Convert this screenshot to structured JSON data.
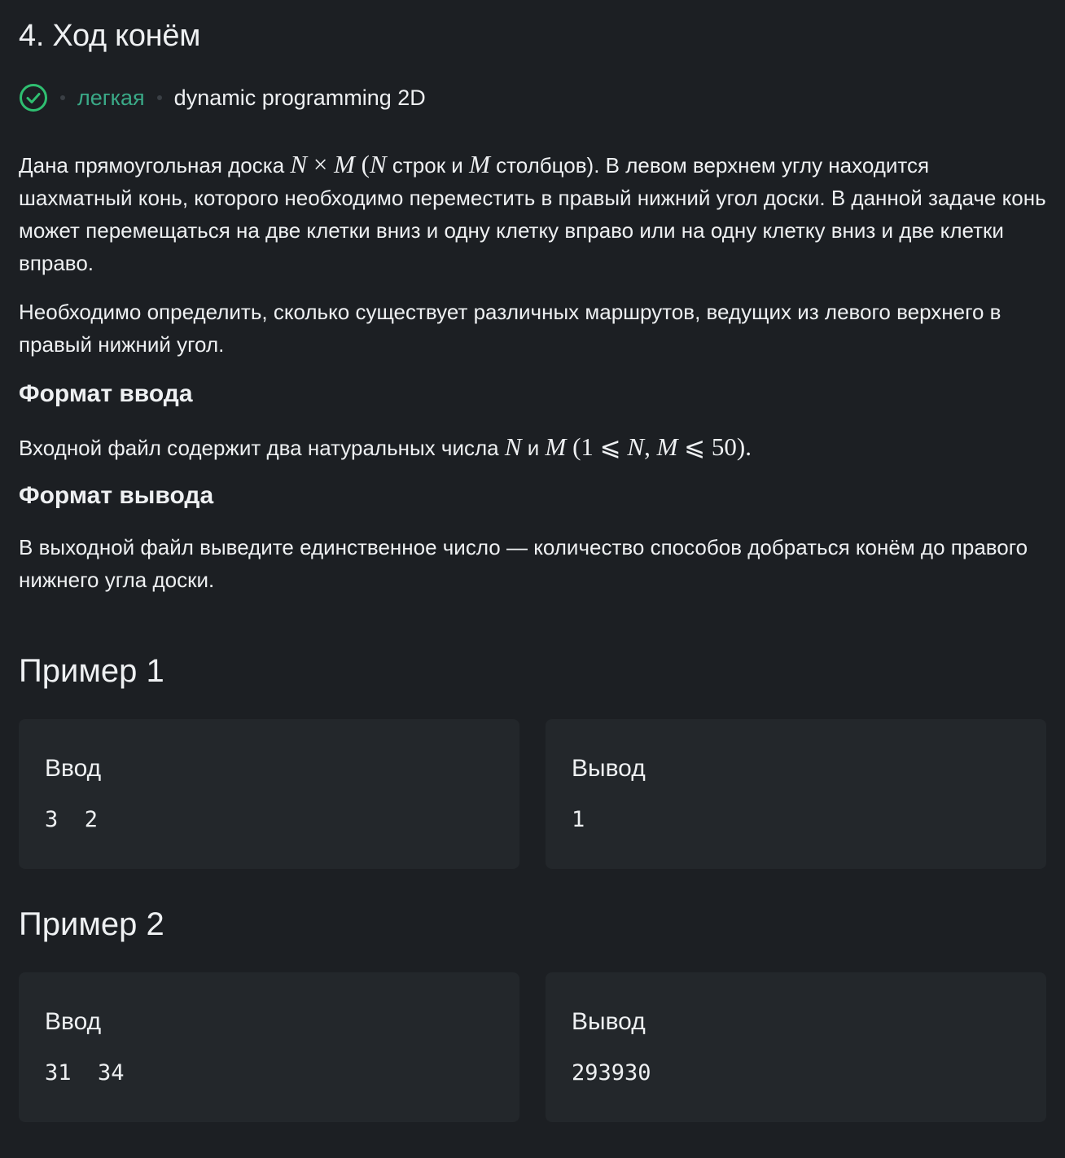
{
  "title": "4. Ход конём",
  "meta": {
    "difficulty": "легкая",
    "topic": "dynamic programming 2D",
    "accent": "#2fbf71"
  },
  "statement": {
    "p1": {
      "t1": "Дана прямоугольная доска ",
      "N": "N",
      "times": " × ",
      "M": "M",
      "t2": " (",
      "N2": "N",
      "t3": " строк и ",
      "M2": "M",
      "t4": " столбцов). В левом верхнем углу находится шахматный конь, которого необходимо переместить в правый нижний угол доски. В данной задаче конь может перемещаться на две клетки вниз и одну клетку вправо или на одну клетку вниз и две клетки вправо."
    },
    "p2": "Необходимо определить, сколько существует различных маршрутов, ведущих из левого верхнего в правый нижний угол."
  },
  "input_format": {
    "heading": "Формат ввода",
    "t1": "Входной файл содержит два натуральных числа ",
    "N": "N",
    "t2": " и ",
    "M": "M",
    "t3": " (1 ⩽ ",
    "N2": "N",
    "comma": ", ",
    "M2": "M",
    "t4": " ⩽ 50)."
  },
  "output_format": {
    "heading": "Формат вывода",
    "text": "В выходной файл выведите единственное число — количество способов добраться конём до правого нижнего угла доски."
  },
  "examples": [
    {
      "title": "Пример 1",
      "input_label": "Ввод",
      "input": "3 2",
      "output_label": "Вывод",
      "output": "1"
    },
    {
      "title": "Пример 2",
      "input_label": "Ввод",
      "input": "31 34",
      "output_label": "Вывод",
      "output": "293930"
    }
  ]
}
